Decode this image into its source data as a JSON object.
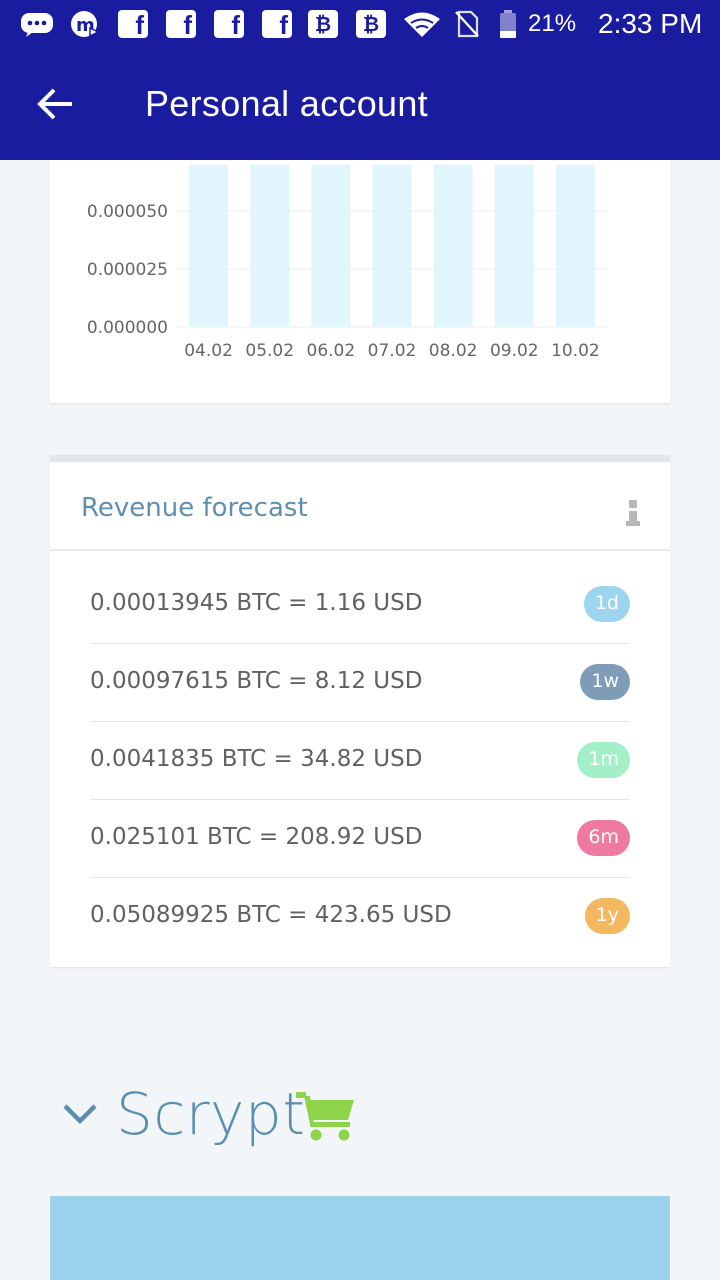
{
  "status_bar": {
    "battery_percent": "21%",
    "time": "2:33 PM",
    "icons": [
      "chat-bubble-icon",
      "m-app-icon",
      "facebook-icon",
      "facebook-icon",
      "facebook-icon",
      "facebook-icon",
      "bitcoin-chart-icon",
      "bitcoin-chart-icon",
      "wifi-icon",
      "no-sim-icon",
      "battery-icon"
    ]
  },
  "app_bar": {
    "title": "Personal account",
    "back_icon": "arrow-left-icon"
  },
  "chart_data": {
    "type": "bar",
    "categories": [
      "04.02",
      "05.02",
      "06.02",
      "07.02",
      "08.02",
      "09.02",
      "10.02"
    ],
    "ytick_labels": [
      "0.000000",
      "0.000025",
      "0.000050"
    ],
    "yticks": [
      0,
      2.5e-05,
      5e-05
    ],
    "ylim": [
      0,
      7.5e-05
    ],
    "values": [
      7e-05,
      7e-05,
      7e-05,
      7e-05,
      7e-05,
      7e-05,
      7e-05
    ],
    "bar_color": "#e1f5fc",
    "grid": true,
    "title": "",
    "xlabel": "",
    "ylabel": ""
  },
  "forecast": {
    "title": "Revenue forecast",
    "info_icon": "info-icon",
    "rows": [
      {
        "text": "0.00013945 BTC = 1.16 USD",
        "badge": "1d",
        "color": "#9dd4f0"
      },
      {
        "text": "0.00097615 BTC = 8.12 USD",
        "badge": "1w",
        "color": "#7f9cb6"
      },
      {
        "text": "0.0041835 BTC = 34.82 USD",
        "badge": "1m",
        "color": "#a3efc7"
      },
      {
        "text": "0.025101 BTC = 208.92 USD",
        "badge": "6m",
        "color": "#ee7aa0"
      },
      {
        "text": "0.05089925 BTC = 423.65 USD",
        "badge": "1y",
        "color": "#f4b860"
      }
    ]
  },
  "section": {
    "title": "Scrypt",
    "chevron_icon": "chevron-down-icon",
    "cart_icon": "shopping-cart-icon",
    "cart_color": "#8ed44a",
    "panel_color": "#9dd2ec"
  }
}
